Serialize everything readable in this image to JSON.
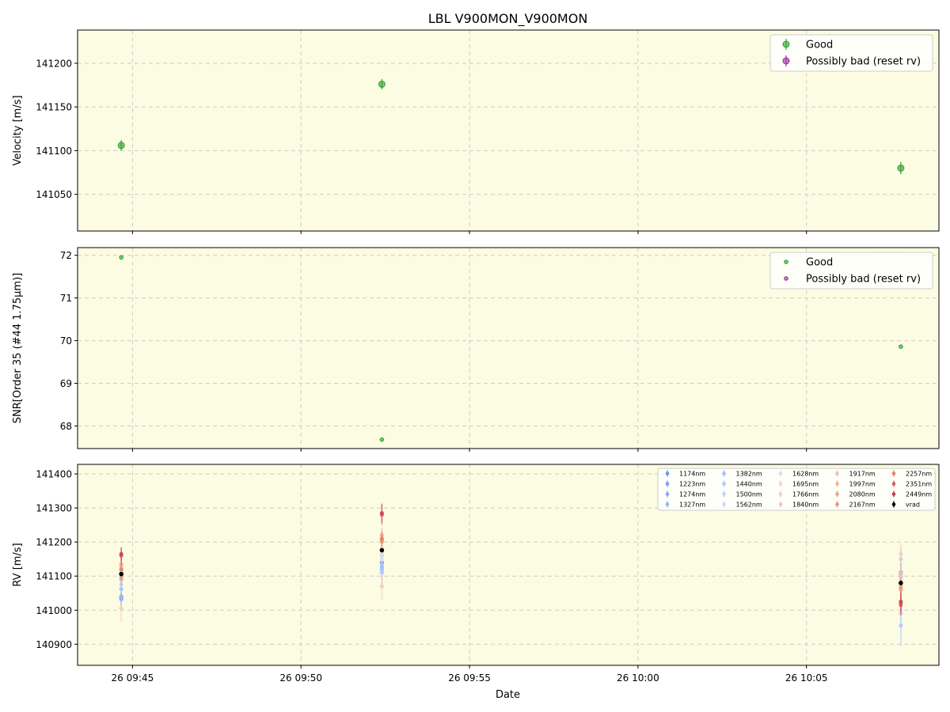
{
  "figure": {
    "title": "LBL V900MON_V900MON",
    "xlabel": "Date",
    "x_tick_labels": [
      "26 09:45",
      "26 09:50",
      "26 09:55",
      "26 10:00",
      "26 10:05"
    ],
    "x_ticks_min": [
      45,
      50,
      55,
      60,
      65
    ],
    "xlim_min": [
      43.37,
      68.93
    ],
    "background": "#fcfce3",
    "grid_color": "#cccccc"
  },
  "chart_data": [
    {
      "type": "scatter",
      "panel": "velocity",
      "ylabel": "Velocity [m/s]",
      "ylim": [
        141008,
        141238
      ],
      "yticks": [
        141050,
        141100,
        141150,
        141200
      ],
      "grid": true,
      "legend_position": "top-right",
      "series": [
        {
          "name": "Good",
          "color": "#2ca02c",
          "x": [
            "26 09:44:40",
            "26 09:52:24",
            "26 10:07:48"
          ],
          "y": [
            141106,
            141176,
            141080
          ],
          "yerr": [
            6,
            6,
            7
          ]
        },
        {
          "name": "Possibly bad (reset rv)",
          "color": "#9b2c9b",
          "x": [],
          "y": [],
          "yerr": []
        }
      ]
    },
    {
      "type": "scatter",
      "panel": "snr",
      "ylabel": "SNR[Order 35 (#44 1.75μm)]",
      "ylim": [
        67.47,
        72.18
      ],
      "yticks": [
        68,
        69,
        70,
        71,
        72
      ],
      "grid": true,
      "legend_position": "top-right",
      "series": [
        {
          "name": "Good",
          "color": "#2ca02c",
          "x": [
            "26 09:44:40",
            "26 09:52:24",
            "26 10:07:48"
          ],
          "y": [
            71.95,
            67.68,
            69.86
          ]
        },
        {
          "name": "Possibly bad (reset rv)",
          "color": "#9b2c9b",
          "x": [],
          "y": []
        }
      ]
    },
    {
      "type": "scatter",
      "panel": "rv_per_band",
      "ylabel": "RV [m/s]",
      "ylim": [
        140838,
        141428
      ],
      "yticks": [
        140900,
        141000,
        141100,
        141200,
        141300,
        141400
      ],
      "grid": true,
      "legend_position": "top-right",
      "x": [
        "26 09:44:40",
        "26 09:52:24",
        "26 10:07:48"
      ],
      "series": [
        {
          "name": "1174nm",
          "color": "#6f92f3",
          "y": [
            141040,
            141140,
            141112
          ],
          "yerr": [
            22,
            18,
            28
          ]
        },
        {
          "name": "1223nm",
          "color": "#7a9df8",
          "y": [
            141032,
            141138,
            141110
          ],
          "yerr": [
            22,
            18,
            28
          ]
        },
        {
          "name": "1274nm",
          "color": "#86a8fa",
          "y": [
            141036,
            141128,
            141105
          ],
          "yerr": [
            20,
            16,
            26
          ]
        },
        {
          "name": "1327nm",
          "color": "#94b4fc",
          "y": [
            141062,
            141120,
            141098
          ],
          "yerr": [
            22,
            18,
            28
          ]
        },
        {
          "name": "1382nm",
          "color": "#a2bffe",
          "y": [
            141090,
            141110,
            140955
          ],
          "yerr": [
            40,
            35,
            60
          ]
        },
        {
          "name": "1440nm",
          "color": "#b1c9fd",
          "y": [
            141120,
            141115,
            141150
          ],
          "yerr": [
            30,
            25,
            35
          ]
        },
        {
          "name": "1500nm",
          "color": "#bfd2fb",
          "y": [
            141075,
            141160,
            140990
          ],
          "yerr": [
            26,
            24,
            40
          ]
        },
        {
          "name": "1562nm",
          "color": "#ccd9f7",
          "y": [
            141100,
            141170,
            141060
          ],
          "yerr": [
            24,
            22,
            36
          ]
        },
        {
          "name": "1628nm",
          "color": "#d8ddea",
          "y": [
            141110,
            141150,
            141090
          ],
          "yerr": [
            22,
            20,
            30
          ]
        },
        {
          "name": "1695nm",
          "color": "#e4dbd5",
          "y": [
            141115,
            141165,
            141070
          ],
          "yerr": [
            24,
            22,
            30
          ]
        },
        {
          "name": "1766nm",
          "color": "#eed3c4",
          "y": [
            141125,
            141180,
            141100
          ],
          "yerr": [
            22,
            20,
            28
          ]
        },
        {
          "name": "1840nm",
          "color": "#f3c9b4",
          "y": [
            141005,
            141070,
            141165
          ],
          "yerr": [
            40,
            40,
            30
          ]
        },
        {
          "name": "1917nm",
          "color": "#f5bea3",
          "y": [
            141130,
            141210,
            141110
          ],
          "yerr": [
            24,
            22,
            30
          ]
        },
        {
          "name": "1997nm",
          "color": "#f4b093",
          "y": [
            141110,
            141200,
            141060
          ],
          "yerr": [
            22,
            22,
            28
          ]
        },
        {
          "name": "2080nm",
          "color": "#f1a283",
          "y": [
            141135,
            141220,
            141075
          ],
          "yerr": [
            24,
            22,
            30
          ]
        },
        {
          "name": "2167nm",
          "color": "#ec9373",
          "y": [
            141095,
            141205,
            141065
          ],
          "yerr": [
            22,
            22,
            28
          ]
        },
        {
          "name": "2257nm",
          "color": "#e48265",
          "y": [
            141120,
            141210,
            141020
          ],
          "yerr": [
            22,
            22,
            30
          ]
        },
        {
          "name": "2351nm",
          "color": "#d85f55",
          "y": [
            141160,
            141280,
            141015
          ],
          "yerr": [
            22,
            30,
            30
          ]
        },
        {
          "name": "2449nm",
          "color": "#c73c4a",
          "y": [
            141165,
            141285,
            141025
          ],
          "yerr": [
            20,
            28,
            30
          ]
        },
        {
          "name": "vrad",
          "color": "#000000",
          "y": [
            141106,
            141176,
            141080
          ],
          "yerr": [
            6,
            6,
            7
          ]
        }
      ]
    }
  ]
}
